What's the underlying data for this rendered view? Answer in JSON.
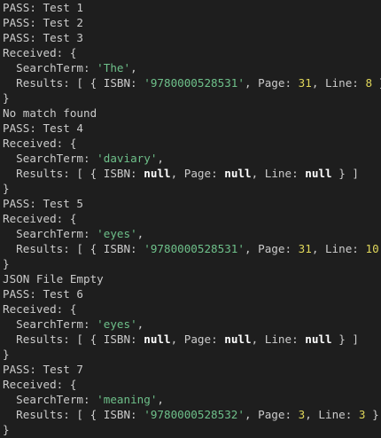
{
  "lines": [
    [
      {
        "t": "PASS: Test 1",
        "c": "plain"
      }
    ],
    [
      {
        "t": "PASS: Test 2",
        "c": "plain"
      }
    ],
    [
      {
        "t": "PASS: Test 3",
        "c": "plain"
      }
    ],
    [
      {
        "t": "Received: {",
        "c": "plain"
      }
    ],
    [
      {
        "t": "  SearchTerm: ",
        "c": "plain"
      },
      {
        "t": "'The'",
        "c": "str"
      },
      {
        "t": ",",
        "c": "plain"
      }
    ],
    [
      {
        "t": "  Results: [ { ISBN: ",
        "c": "plain"
      },
      {
        "t": "'9780000528531'",
        "c": "str"
      },
      {
        "t": ", Page: ",
        "c": "plain"
      },
      {
        "t": "31",
        "c": "num"
      },
      {
        "t": ", Line: ",
        "c": "plain"
      },
      {
        "t": "8",
        "c": "num"
      },
      {
        "t": " } ]",
        "c": "plain"
      }
    ],
    [
      {
        "t": "}",
        "c": "plain"
      }
    ],
    [
      {
        "t": "No match found",
        "c": "plain"
      }
    ],
    [
      {
        "t": "PASS: Test 4",
        "c": "plain"
      }
    ],
    [
      {
        "t": "Received: {",
        "c": "plain"
      }
    ],
    [
      {
        "t": "  SearchTerm: ",
        "c": "plain"
      },
      {
        "t": "'daviary'",
        "c": "str"
      },
      {
        "t": ",",
        "c": "plain"
      }
    ],
    [
      {
        "t": "  Results: [ { ISBN: ",
        "c": "plain"
      },
      {
        "t": "null",
        "c": "nul"
      },
      {
        "t": ", Page: ",
        "c": "plain"
      },
      {
        "t": "null",
        "c": "nul"
      },
      {
        "t": ", Line: ",
        "c": "plain"
      },
      {
        "t": "null",
        "c": "nul"
      },
      {
        "t": " } ]",
        "c": "plain"
      }
    ],
    [
      {
        "t": "}",
        "c": "plain"
      }
    ],
    [
      {
        "t": "PASS: Test 5",
        "c": "plain"
      }
    ],
    [
      {
        "t": "Received: {",
        "c": "plain"
      }
    ],
    [
      {
        "t": "  SearchTerm: ",
        "c": "plain"
      },
      {
        "t": "'eyes'",
        "c": "str"
      },
      {
        "t": ",",
        "c": "plain"
      }
    ],
    [
      {
        "t": "  Results: [ { ISBN: ",
        "c": "plain"
      },
      {
        "t": "'9780000528531'",
        "c": "str"
      },
      {
        "t": ", Page: ",
        "c": "plain"
      },
      {
        "t": "31",
        "c": "num"
      },
      {
        "t": ", Line: ",
        "c": "plain"
      },
      {
        "t": "10",
        "c": "num"
      },
      {
        "t": " } ]",
        "c": "plain"
      }
    ],
    [
      {
        "t": "}",
        "c": "plain"
      }
    ],
    [
      {
        "t": "JSON File Empty",
        "c": "plain"
      }
    ],
    [
      {
        "t": "PASS: Test 6",
        "c": "plain"
      }
    ],
    [
      {
        "t": "Received: {",
        "c": "plain"
      }
    ],
    [
      {
        "t": "  SearchTerm: ",
        "c": "plain"
      },
      {
        "t": "'eyes'",
        "c": "str"
      },
      {
        "t": ",",
        "c": "plain"
      }
    ],
    [
      {
        "t": "  Results: [ { ISBN: ",
        "c": "plain"
      },
      {
        "t": "null",
        "c": "nul"
      },
      {
        "t": ", Page: ",
        "c": "plain"
      },
      {
        "t": "null",
        "c": "nul"
      },
      {
        "t": ", Line: ",
        "c": "plain"
      },
      {
        "t": "null",
        "c": "nul"
      },
      {
        "t": " } ]",
        "c": "plain"
      }
    ],
    [
      {
        "t": "}",
        "c": "plain"
      }
    ],
    [
      {
        "t": "PASS: Test 7",
        "c": "plain"
      }
    ],
    [
      {
        "t": "Received: {",
        "c": "plain"
      }
    ],
    [
      {
        "t": "  SearchTerm: ",
        "c": "plain"
      },
      {
        "t": "'meaning'",
        "c": "str"
      },
      {
        "t": ",",
        "c": "plain"
      }
    ],
    [
      {
        "t": "  Results: [ { ISBN: ",
        "c": "plain"
      },
      {
        "t": "'9780000528532'",
        "c": "str"
      },
      {
        "t": ", Page: ",
        "c": "plain"
      },
      {
        "t": "3",
        "c": "num"
      },
      {
        "t": ", Line: ",
        "c": "plain"
      },
      {
        "t": "3",
        "c": "num"
      },
      {
        "t": " } ]",
        "c": "plain"
      }
    ],
    [
      {
        "t": "}",
        "c": "plain"
      }
    ]
  ],
  "colors": {
    "background": "#1e1e1e",
    "text": "#cccccc",
    "string": "#6ec08a",
    "number": "#dfd65a",
    "null": "#ffffff"
  }
}
